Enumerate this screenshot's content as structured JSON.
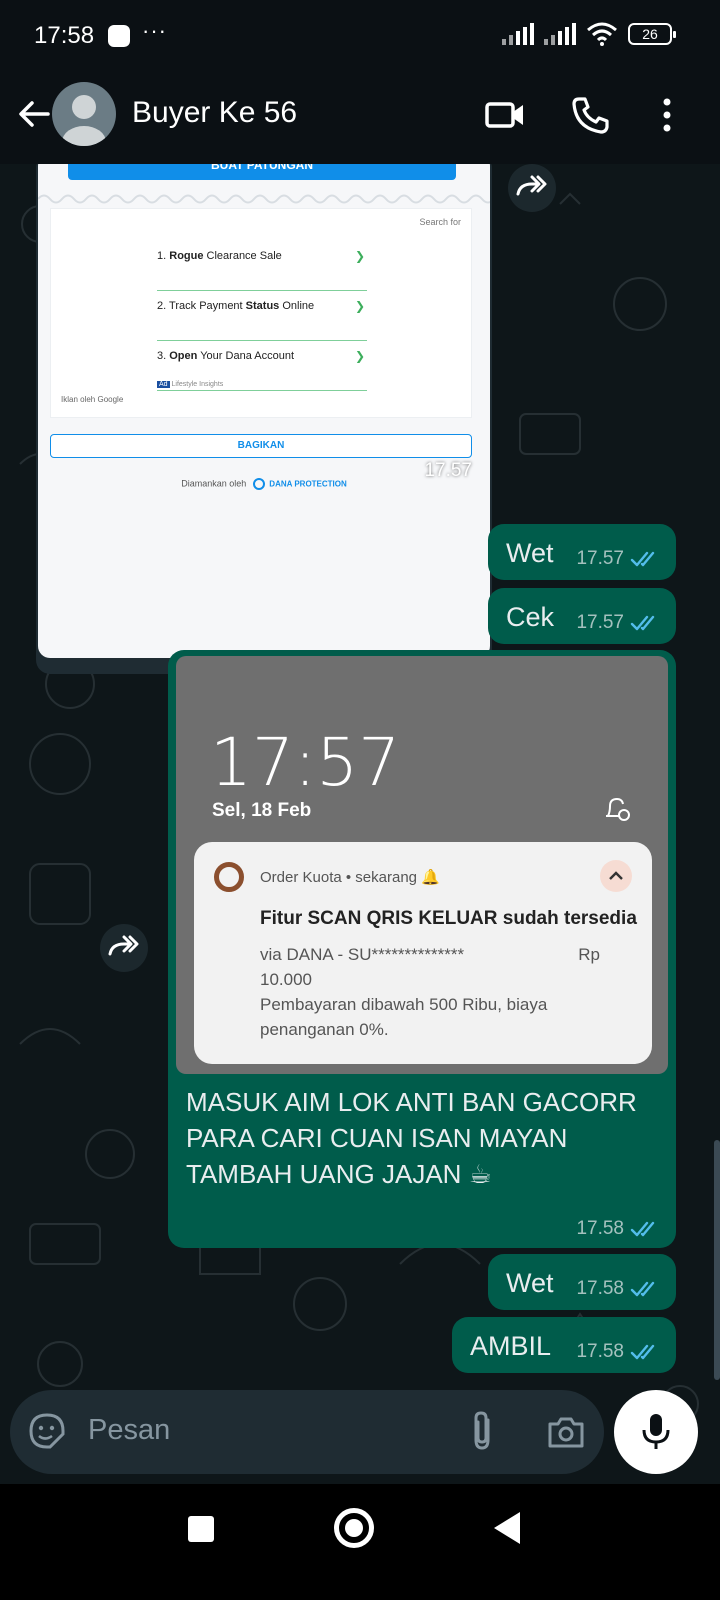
{
  "status_bar": {
    "time": "17:58",
    "dots": "···",
    "battery": "26"
  },
  "header": {
    "contact_name": "Buyer Ke 56"
  },
  "image1": {
    "buat_patungan": "BUAT PATUNGAN",
    "search_for": "Search for",
    "ads": [
      {
        "num": "1.",
        "bold": "Rogue",
        "rest": " Clearance Sale"
      },
      {
        "num": "2.",
        "pre": "Track Payment ",
        "bold": "Status",
        "rest": " Online"
      },
      {
        "num": "3.",
        "bold": "Open",
        "rest": " Your Dana Account"
      }
    ],
    "ad_source": "Lifestyle Insights",
    "ad_by": "Iklan oleh Google",
    "bagikan": "BAGIKAN",
    "secured_by": "Diamankan oleh",
    "dana_protection": "DANA PROTECTION",
    "timestamp": "17.57"
  },
  "messages": [
    {
      "text": "Wet",
      "time": "17.57"
    },
    {
      "text": "Cek",
      "time": "17.57"
    },
    {
      "text": "Wet",
      "time": "17.58"
    },
    {
      "text": "AMBIL",
      "time": "17.58"
    }
  ],
  "image2": {
    "lock_time": "17:57",
    "lock_date": "Sel, 18 Feb",
    "notif_app": "Order Kuota • sekarang",
    "notif_title": "Fitur SCAN QRIS KELUAR sudah tersedia",
    "notif_line1": "via DANA - SU**************",
    "notif_rp": "Rp",
    "notif_line2": "10.000",
    "notif_line3": "Pembayaran dibawah 500 Ribu, biaya penanganan 0%.",
    "caption": "MASUK AIM LOK ANTI BAN GACORR PARA CARI CUAN ISAN MAYAN TAMBAH UANG JAJAN ☕",
    "time": "17.58"
  },
  "input": {
    "placeholder": "Pesan"
  },
  "colors": {
    "outgoing_bubble": "#005c4b",
    "read_ticks": "#53bdeb",
    "header_bg": "#0b1014",
    "chat_bg": "#0e1619"
  }
}
